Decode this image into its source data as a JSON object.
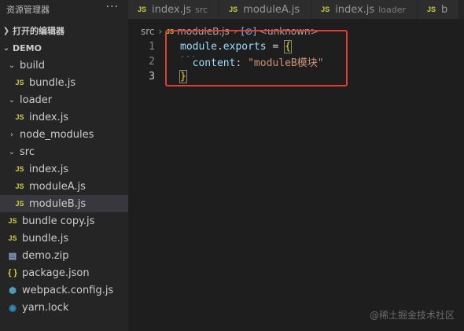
{
  "sidebar": {
    "title": "资源管理器",
    "more_icon": "···",
    "open_editors_label": "打开的编辑器",
    "workspace_label": "DEMO",
    "tree": [
      {
        "label": "build",
        "type": "folder",
        "depth": 0,
        "expanded": true
      },
      {
        "label": "bundle.js",
        "type": "js",
        "depth": 1
      },
      {
        "label": "loader",
        "type": "folder",
        "depth": 0,
        "expanded": true
      },
      {
        "label": "index.js",
        "type": "js",
        "depth": 1
      },
      {
        "label": "node_modules",
        "type": "folder",
        "depth": 0,
        "expanded": false
      },
      {
        "label": "src",
        "type": "folder",
        "depth": 0,
        "expanded": true
      },
      {
        "label": "index.js",
        "type": "js",
        "depth": 1
      },
      {
        "label": "moduleA.js",
        "type": "js",
        "depth": 1
      },
      {
        "label": "moduleB.js",
        "type": "js",
        "depth": 1,
        "selected": true
      },
      {
        "label": "bundle copy.js",
        "type": "js",
        "depth": 0
      },
      {
        "label": "bundle.js",
        "type": "js",
        "depth": 0
      },
      {
        "label": "demo.zip",
        "type": "zip",
        "depth": 0
      },
      {
        "label": "package.json",
        "type": "json",
        "depth": 0
      },
      {
        "label": "webpack.config.js",
        "type": "cfg",
        "depth": 0
      },
      {
        "label": "yarn.lock",
        "type": "yarn",
        "depth": 0
      }
    ]
  },
  "tabs": [
    {
      "label": "index.js",
      "description": "src"
    },
    {
      "label": "moduleA.js",
      "description": ""
    },
    {
      "label": "index.js",
      "description": "loader"
    },
    {
      "label": "b",
      "description": ""
    }
  ],
  "breadcrumb": {
    "folder": "src",
    "file": "moduleB.js",
    "symbol": "<unknown>"
  },
  "editor": {
    "lines": [
      {
        "number": "1"
      },
      {
        "number": "2"
      },
      {
        "number": "3"
      }
    ],
    "line1": {
      "object": "module",
      "dot": ".",
      "prop": "exports",
      "assign": " = ",
      "open": "{"
    },
    "line2": {
      "indent": "  ",
      "key": "content",
      "colon": ": ",
      "value": "\"moduleB模块\""
    },
    "line3": {
      "close": "}"
    }
  },
  "watermark": "@稀土掘金技术社区",
  "icons": {
    "js": "JS",
    "zip": "zip-icon",
    "json": "{ }",
    "webpack": "webpack-icon",
    "yarn": "yarn-icon"
  },
  "colors": {
    "annotation_box": "#e03c31",
    "js_icon": "#cbcb41"
  }
}
